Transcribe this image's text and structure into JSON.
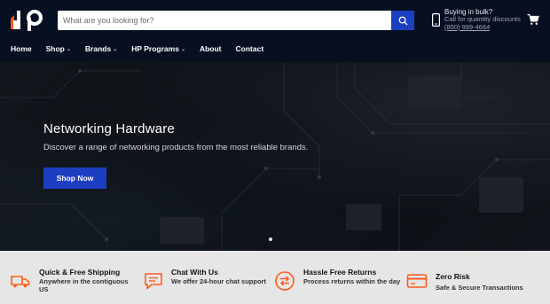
{
  "header": {
    "logo": "dp",
    "search": {
      "placeholder": "What are you looking for?"
    },
    "contact": {
      "title": "Buying in bulk?",
      "subtitle": "Call for quantity discounts",
      "phone": "(850) 999-4664"
    }
  },
  "nav": {
    "items": [
      {
        "label": "Home",
        "dropdown": false
      },
      {
        "label": "Shop",
        "dropdown": true
      },
      {
        "label": "Brands",
        "dropdown": true
      },
      {
        "label": "HP Programs",
        "dropdown": true
      },
      {
        "label": "About",
        "dropdown": false
      },
      {
        "label": "Contact",
        "dropdown": false
      }
    ]
  },
  "hero": {
    "title": "Networking Hardware",
    "subtitle": "Discover a range of networking products from the most reliable brands.",
    "button": "Shop Now"
  },
  "features": [
    {
      "icon": "truck-icon",
      "title": "Quick & Free Shipping",
      "desc": "Anywhere in the contiguous US"
    },
    {
      "icon": "chat-icon",
      "title": "Chat With Us",
      "desc": "We offer 24-hour chat support"
    },
    {
      "icon": "returns-icon",
      "title": "Hassle Free Returns",
      "desc": "Process returns within the day"
    },
    {
      "icon": "credit-card-icon",
      "title": "Zero Risk",
      "desc": "Safe & Secure Transactions"
    }
  ],
  "colors": {
    "header_bg": "#061021",
    "accent_blue": "#1c3fc2",
    "feature_icon_orange": "#ff5a1f",
    "feature_bar_bg": "#e6e6e6"
  }
}
